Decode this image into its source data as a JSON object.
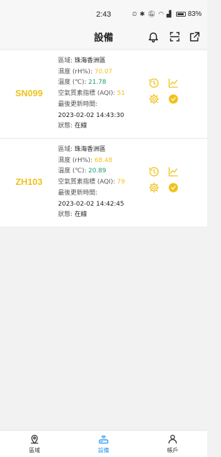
{
  "status_bar": {
    "time": "2:43",
    "battery": "83%"
  },
  "header": {
    "title": "設備"
  },
  "devices": [
    {
      "id": "SN099",
      "region_label": "區域: ",
      "region": "珠海香洲區",
      "humidity_label": "濕度 (rH%): ",
      "humidity": "70.07",
      "temperature_label": "溫度 (℃): ",
      "temperature": "21.78",
      "aqi_label": "空氣質素指標 (AQI): ",
      "aqi": "51",
      "updated_label": "最後更新時間:",
      "updated": "2023-02-02 14:43:30",
      "status_label": "狀態: ",
      "status": "在線"
    },
    {
      "id": "ZH103",
      "region_label": "區域: ",
      "region": "珠海香洲區",
      "humidity_label": "濕度 (rH%): ",
      "humidity": "68.48",
      "temperature_label": "溫度 (℃): ",
      "temperature": "20.89",
      "aqi_label": "空氣質素指標 (AQI): ",
      "aqi": "79",
      "updated_label": "最後更新時間:",
      "updated": "2023-02-02 14:42:45",
      "status_label": "狀態: ",
      "status": "在線"
    }
  ],
  "tabs": [
    {
      "label": "區域",
      "icon": "location-pin-icon"
    },
    {
      "label": "設備",
      "icon": "router-icon"
    },
    {
      "label": "帳戶",
      "icon": "person-icon"
    }
  ],
  "colors": {
    "accent_yellow": "#f0c21a",
    "temperature_green": "#1b9a6e",
    "active_blue": "#2196f3"
  }
}
